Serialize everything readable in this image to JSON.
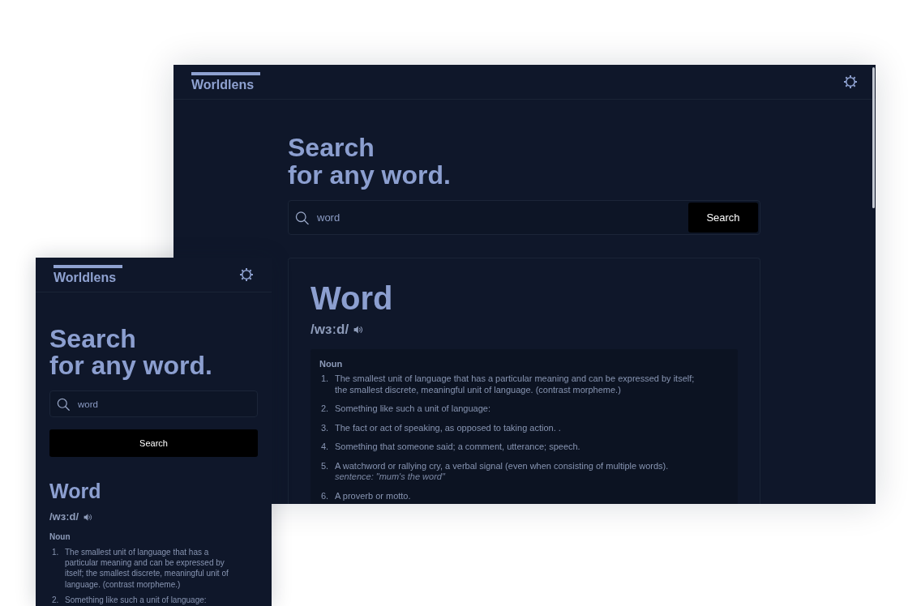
{
  "views": [
    {
      "kind": "desktop",
      "app_name": "Worldlens",
      "heading": "Search\nfor any word.",
      "search": {
        "value": "word"
      },
      "search_button": "Search",
      "entry": {
        "word": "Word",
        "phonetic": "/wɜːd/",
        "meanings": [
          {
            "part_of_speech": "Noun",
            "definitions": [
              {
                "number": "1.",
                "text": "The smallest unit of language that has a particular meaning and can be expressed by itself; the smallest discrete, meaningful unit of language. (contrast morpheme.)"
              },
              {
                "number": "2.",
                "text": "Something like such a unit of language:"
              },
              {
                "number": "3.",
                "text": "The fact or act of speaking, as opposed to taking action. ."
              },
              {
                "number": "4.",
                "text": "Something that someone said; a comment, utterance; speech."
              },
              {
                "number": "5.",
                "text": "A watchword or rallying cry, a verbal signal (even when consisting of multiple words).",
                "example": "sentence: \"mum's the word\""
              },
              {
                "number": "6.",
                "text": "A proverb or motto."
              }
            ]
          }
        ]
      }
    },
    {
      "kind": "mobile",
      "app_name": "Worldlens",
      "heading": "Search\nfor any word.",
      "search": {
        "value": "word"
      },
      "search_button": "Search",
      "entry": {
        "word": "Word",
        "phonetic": "/wɜːd/",
        "meanings": [
          {
            "part_of_speech": "Noun",
            "definitions": [
              {
                "number": "1.",
                "text": "The smallest unit of language that has a particular meaning and can be expressed by itself; the smallest discrete, meaningful unit of language. (contrast morpheme.)"
              },
              {
                "number": "2.",
                "text": "Something like such a unit of language:"
              }
            ]
          }
        ]
      }
    }
  ]
}
